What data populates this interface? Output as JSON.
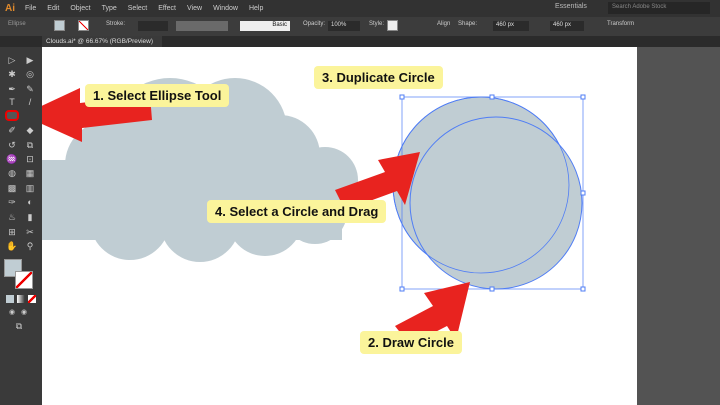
{
  "menubar": {
    "logo": "Ai",
    "items": [
      "File",
      "Edit",
      "Object",
      "Type",
      "Select",
      "Effect",
      "View",
      "Window",
      "Help"
    ],
    "workspace": "Essentials",
    "search_placeholder": "Search Adobe Stock"
  },
  "control": {
    "tool": "Ellipse",
    "stroke_label": "Stroke:",
    "brush": "Basic",
    "opacity_label": "Opacity:",
    "opacity": "100%",
    "style_label": "Style:",
    "align": "Align",
    "shape": "Shape:",
    "width": "460 px",
    "height": "460 px",
    "transform": "Transform"
  },
  "document": {
    "tab": "Clouds.ai* @ 66.67% (RGB/Preview)"
  },
  "colors": {
    "accent": "#e8231f",
    "label_bg": "#fbf49b",
    "shape_fill": "#c0cdd3",
    "selection": "#4f7df5"
  },
  "annotations": {
    "step1": "1. Select Ellipse Tool",
    "step2": "2. Draw Circle",
    "step3": "3. Duplicate Circle",
    "step4": "4. Select a Circle and Drag"
  }
}
